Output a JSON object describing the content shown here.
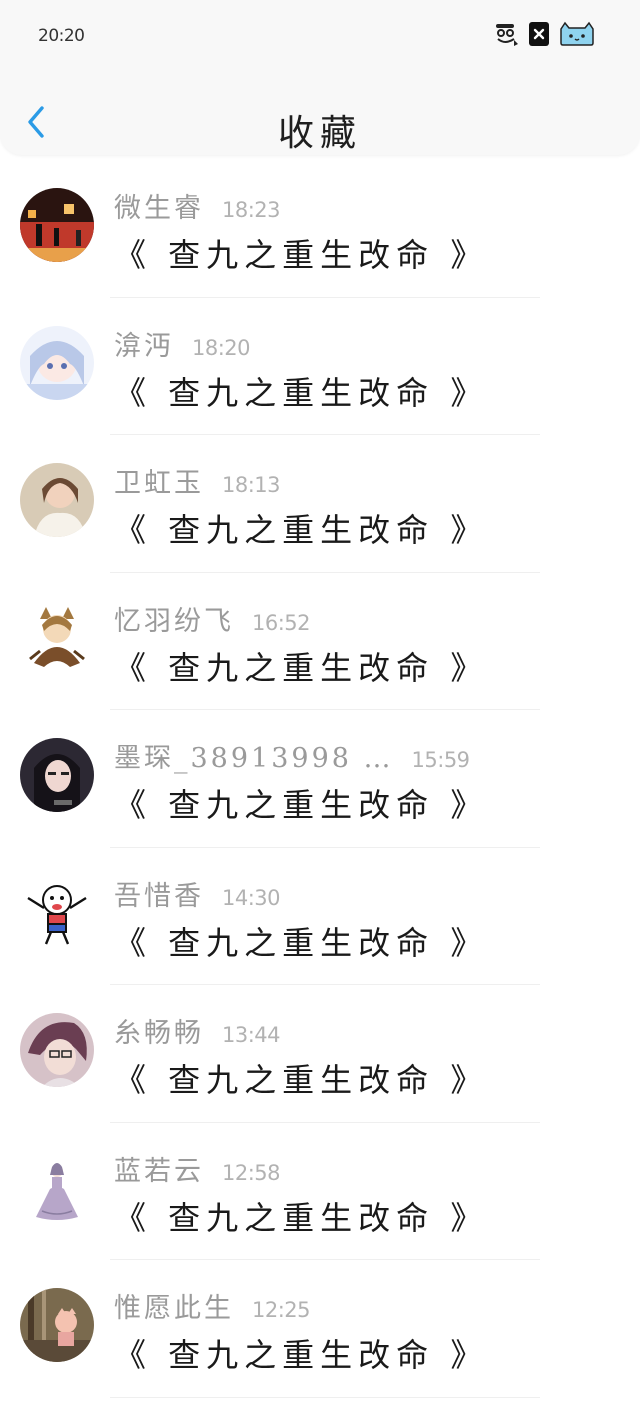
{
  "status_bar": {
    "time": "20:20",
    "icons": [
      "notification-icon",
      "close-box-icon",
      "cat-icon"
    ]
  },
  "header": {
    "title": "收藏",
    "back_icon": "chevron-left-icon",
    "accent_color": "#2b9be6"
  },
  "items": [
    {
      "name": "微生睿",
      "time": "18:23",
      "message": "《 查九之重生改命 》",
      "avatar_color": "#c0392b"
    },
    {
      "name": "渰沔",
      "time": "18:20",
      "message": "《 查九之重生改命 》",
      "avatar_color": "#b9c8e8"
    },
    {
      "name": "卫虹玉",
      "time": "18:13",
      "message": "《 查九之重生改命 》",
      "avatar_color": "#c8b49a"
    },
    {
      "name": "忆羽纷飞",
      "time": "16:52",
      "message": "《 查九之重生改命 》",
      "avatar_color": "#a3783f"
    },
    {
      "name": "墨琛_38913998 …",
      "time": "15:59",
      "message": "《 查九之重生改命 》",
      "avatar_color": "#3a3440"
    },
    {
      "name": "吾惜香",
      "time": "14:30",
      "message": "《 查九之重生改命 》",
      "avatar_color": "#ffffff"
    },
    {
      "name": "糸畅畅",
      "time": "13:44",
      "message": "《 查九之重生改命 》",
      "avatar_color": "#8a6a78"
    },
    {
      "name": "蓝若云",
      "time": "12:58",
      "message": "《 查九之重生改命 》",
      "avatar_color": "#b7a6c9"
    },
    {
      "name": "惟愿此生",
      "time": "12:25",
      "message": "《 查九之重生改命 》",
      "avatar_color": "#8a7a5e"
    }
  ]
}
